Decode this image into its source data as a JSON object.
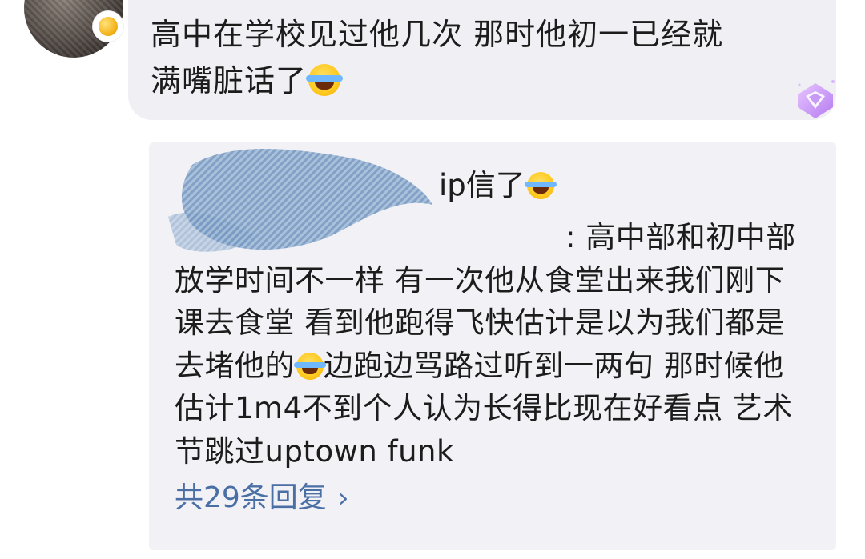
{
  "comment": {
    "text_line1": "高中在学校见过他几次 那时他初一已经就",
    "text_line2": "满嘴脏话了",
    "emoji": "laugh-cry-emoji"
  },
  "reply": {
    "head_visible": "ip信了",
    "line1_visible": ": 高中部和初中部",
    "line2": "放学时间不一样 有一次他从食堂出来我们刚下",
    "line3": "课去食堂 看到他跑得飞快估计是以为我们都是",
    "line4_a": "去堵他的",
    "line4_b": "边跑边骂路过听到一两句 那时候他",
    "line5": "估计1m4不到个人认为长得比现在好看点 艺术",
    "line6": "节跳过uptown funk",
    "more_label": "共29条回复",
    "more_chevron": "›"
  },
  "icons": {
    "avatar_badge": "gold-badge-icon",
    "gem": "purple-diamond-gem-icon"
  },
  "colors": {
    "bubble": "#f0f0f4",
    "reply_card": "#f2f2f6",
    "link": "#4a6fa5",
    "text": "#1c1c1c"
  }
}
